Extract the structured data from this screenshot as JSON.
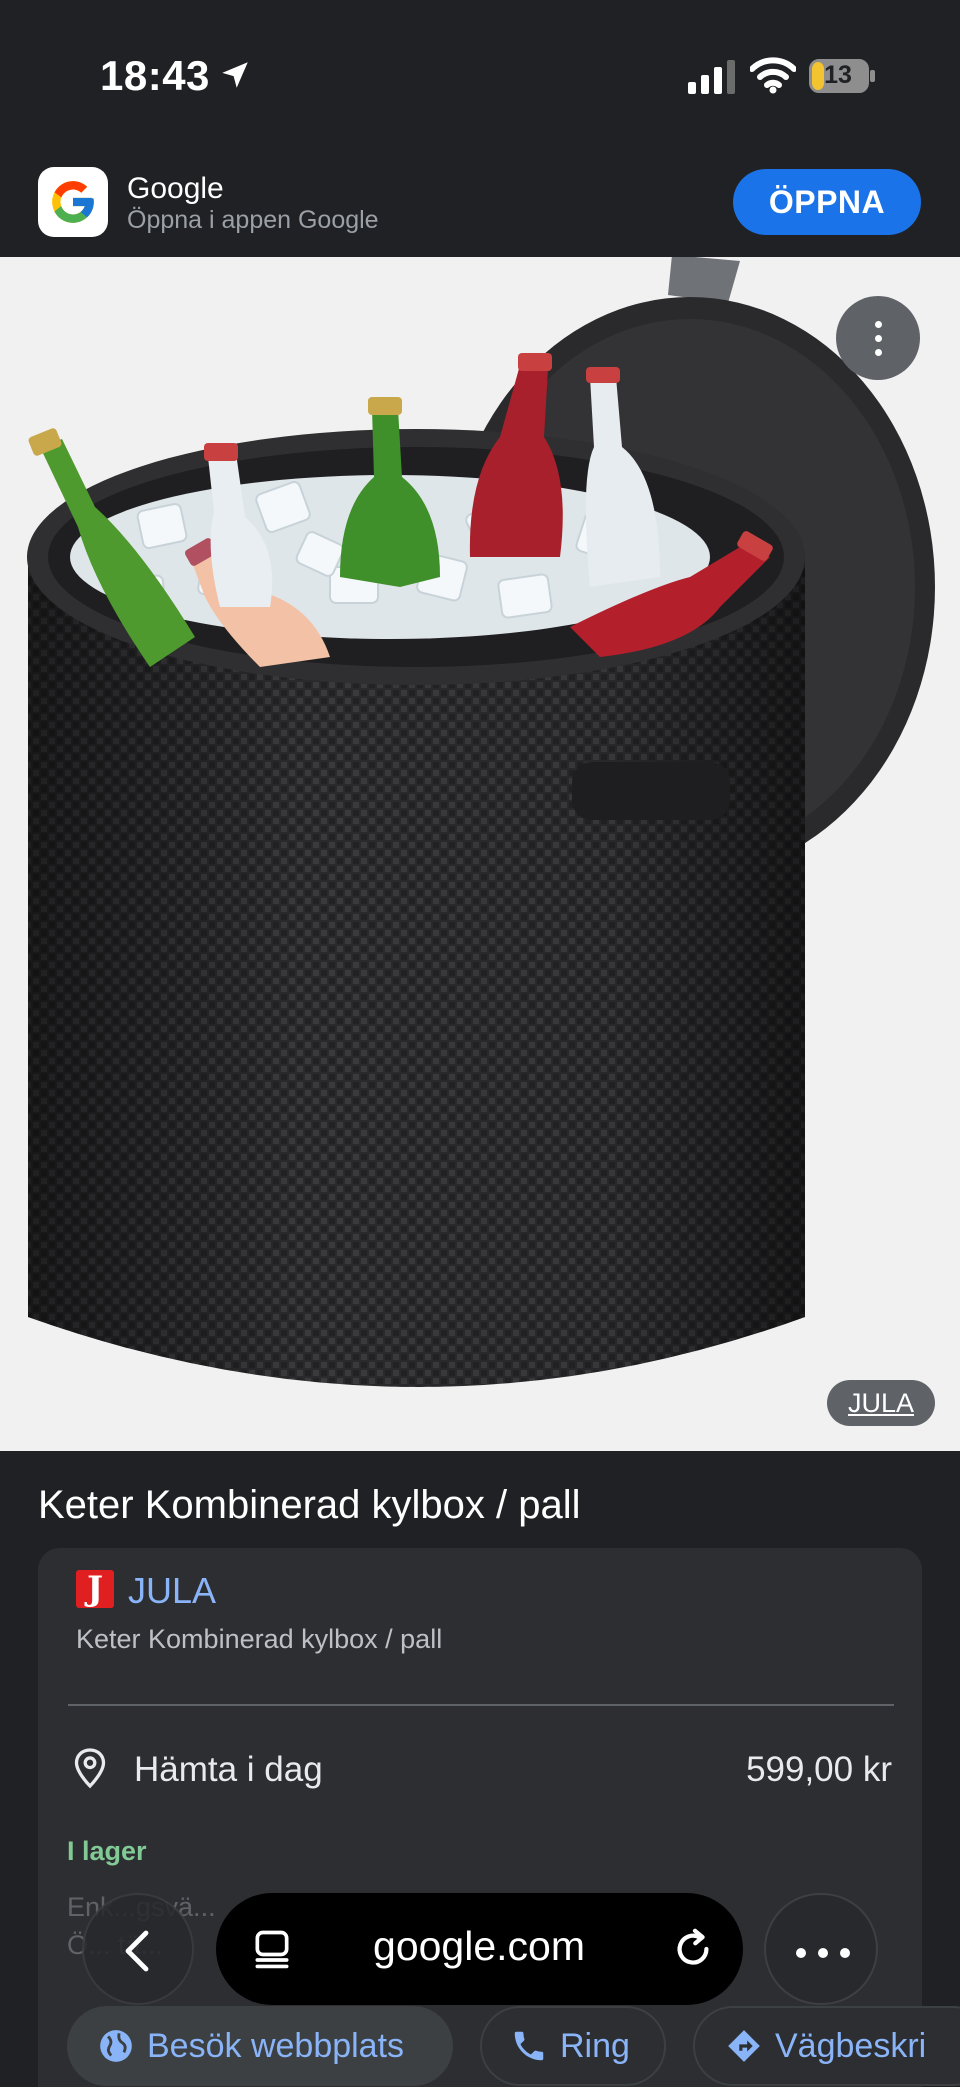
{
  "status_bar": {
    "time": "18:43",
    "battery": "13"
  },
  "app_banner": {
    "title": "Google",
    "subtitle": "Öppna i appen Google",
    "open_label": "ÖPPNA"
  },
  "image": {
    "source_label": "JULA"
  },
  "product": {
    "title": "Keter Kombinerad kylbox / pall"
  },
  "offer": {
    "merchant": "JULA",
    "merchant_logo": "J",
    "item": "Keter Kombinerad kylbox / pall",
    "pickup": "Hämta i dag",
    "price": "599,00 kr",
    "stock": "I lager",
    "address_line1": "Enk...gsvä...",
    "address_line2": "Ö... tä..."
  },
  "actions": {
    "website": "Besök webbplats",
    "call": "Ring",
    "directions": "Vägbeskri"
  },
  "toolbar": {
    "url": "google.com"
  },
  "colors": {
    "accent": "#1a73e8",
    "link": "#8ab4f8",
    "in_stock": "#81c995",
    "jula_red": "#e02020"
  }
}
